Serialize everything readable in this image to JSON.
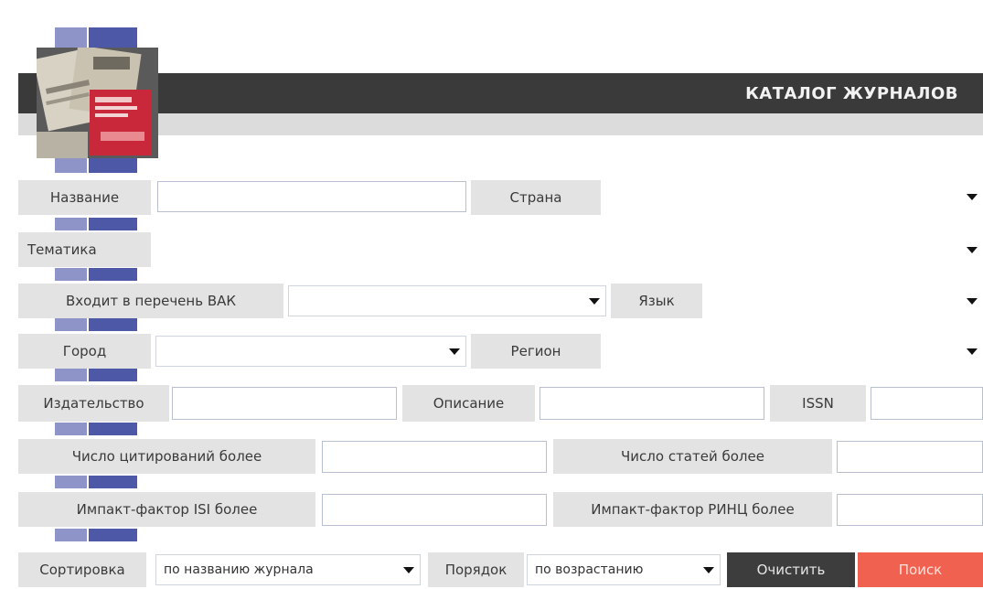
{
  "header": {
    "title": "КАТАЛОГ ЖУРНАЛОВ"
  },
  "logo": {
    "icon": "magazines-collage-image"
  },
  "fields": {
    "name_label": "Название",
    "country_label": "Страна",
    "topic_label": "Тематика",
    "vak_label": "Входит в перечень ВАК",
    "language_label": "Язык",
    "city_label": "Город",
    "region_label": "Регион",
    "publisher_label": "Издательство",
    "description_label": "Описание",
    "issn_label": "ISSN",
    "citations_label": "Число цитирований более",
    "articles_label": "Число статей более",
    "isi_label": "Импакт-фактор ISI более",
    "rinc_label": "Импакт-фактор РИНЦ более"
  },
  "controls": {
    "sort_label": "Сортировка",
    "sort_value": "по названию журнала",
    "order_label": "Порядок",
    "order_value": "по возрастанию",
    "clear_button": "Очистить",
    "search_button": "Поиск"
  },
  "colors": {
    "header_bar": "#3a3a3a",
    "block_light": "#8e93c8",
    "block_dark": "#4d59a6",
    "search_button": "#f06150"
  }
}
